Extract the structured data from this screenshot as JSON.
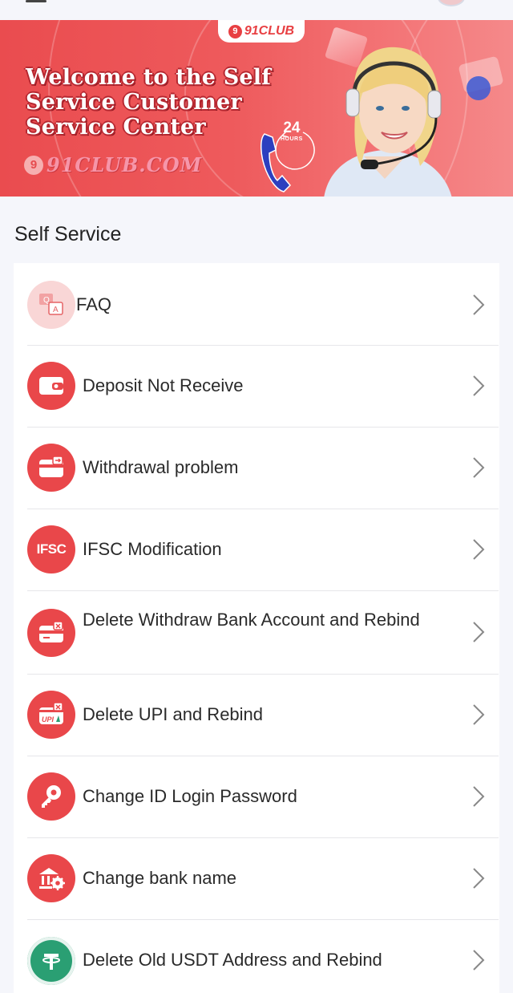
{
  "banner": {
    "brand": "91CLUB",
    "title_line1": "Welcome to the Self",
    "title_line2": "Service Customer",
    "title_line3": "Service Center",
    "domain": "91CLUB.COM",
    "hours_num": "24",
    "hours_label": "HOURS"
  },
  "section_title": "Self Service",
  "items": [
    {
      "label": "FAQ",
      "icon": "faq-icon"
    },
    {
      "label": "Deposit Not Receive",
      "icon": "wallet-icon"
    },
    {
      "label": "Withdrawal problem",
      "icon": "card-arrow-icon"
    },
    {
      "label": "IFSC Modification",
      "icon": "ifsc-icon"
    },
    {
      "label": "Delete Withdraw Bank Account and Rebind",
      "icon": "card-delete-icon"
    },
    {
      "label": "Delete UPI and Rebind",
      "icon": "upi-delete-icon"
    },
    {
      "label": "Change ID Login Password",
      "icon": "key-icon"
    },
    {
      "label": "Change bank name",
      "icon": "bank-gear-icon"
    },
    {
      "label": "Delete Old USDT Address and Rebind",
      "icon": "usdt-icon"
    }
  ],
  "colors": {
    "accent": "#e9474a",
    "usdt": "#2a9f73"
  }
}
